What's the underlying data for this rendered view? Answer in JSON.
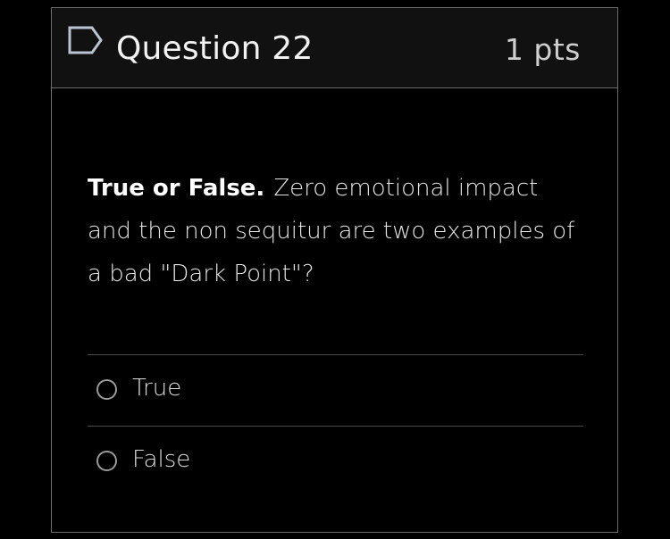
{
  "header": {
    "flag_icon": "flag-outline-icon",
    "title": "Question 22",
    "points": "1 pts"
  },
  "question": {
    "lead": "True or False.",
    "body": "Zero emotional impact and the non sequitur are two examples of a bad \"Dark Point\"?"
  },
  "answers": [
    {
      "label": "True",
      "selected": false
    },
    {
      "label": "False",
      "selected": false
    }
  ],
  "colors": {
    "background": "#000000",
    "header_background": "#111111",
    "border": "#6a6a6a",
    "text": "#e6e6e6"
  }
}
